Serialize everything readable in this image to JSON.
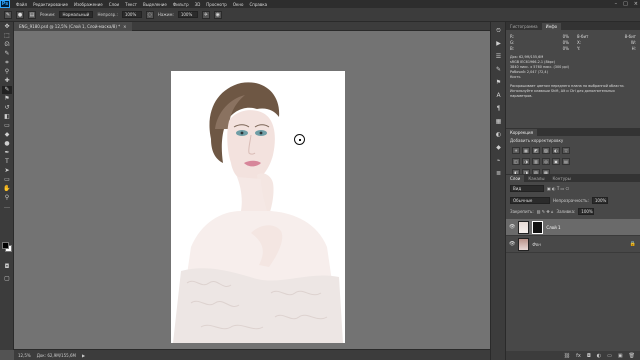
{
  "app": {
    "logo": "Ps"
  },
  "menu": [
    "Файл",
    "Редактирование",
    "Изображение",
    "Слои",
    "Текст",
    "Выделение",
    "Фильтр",
    "3D",
    "Просмотр",
    "Окно",
    "Справка"
  ],
  "window_controls": [
    "–",
    "□",
    "×"
  ],
  "options": {
    "mode_label": "Режим:",
    "mode_value": "Нормальный",
    "opacity_label": "Непрозр.:",
    "opacity_value": "100%",
    "flow_label": "Нажим:",
    "flow_value": "100%"
  },
  "document": {
    "tab_title": "ENG_9180.psd @ 12,5% (Слой 1, Слой-маска/8) *",
    "close": "×",
    "zoom": "12,5%",
    "doc_size": "Док: 62,9М/155,6М"
  },
  "panel_info": {
    "tabs": [
      "Гистограмма",
      "Инфо"
    ],
    "rows": [
      [
        "R:",
        "0%"
      ],
      [
        "G:",
        "0%"
      ],
      [
        "B:",
        "0%"
      ],
      [
        "8-бит",
        "8-бит"
      ],
      [
        "X:",
        "W:"
      ],
      [
        "Y:",
        "H:"
      ]
    ],
    "doc_lines": [
      "Док: 62,9М/155,6М",
      "sRGB IEC61966-2.1 (8bpc)",
      "3840 пикс. x 5760 пикс. (300 ppi)",
      "Рабочий: 2,047 (72,4)",
      "Кисть"
    ],
    "hint": "Раскрашивает цветом переднего плана на выбранной области. Используйте клавиши Shift, Alt и Ctrl для дополнительных параметров."
  },
  "panel_adjustments": {
    "title": "Коррекция",
    "subtitle": "Добавить корректировку",
    "row1": [
      "☀",
      "▦",
      "◩",
      "▨",
      "◐",
      "▽"
    ],
    "row2": [
      "◫",
      "◑",
      "▥",
      "◎",
      "▣",
      "▤"
    ],
    "row3": [
      "◧",
      "◨",
      "▧",
      "▩"
    ]
  },
  "panel_layers": {
    "tabs": [
      "Слои",
      "Каналы",
      "Контуры"
    ],
    "filter_value": "Вид",
    "blend_value": "Обычные",
    "opacity_label": "Непрозрачность:",
    "opacity_value": "100%",
    "lock_label": "Закрепить:",
    "fill_label": "Заливка:",
    "fill_value": "100%",
    "layers": [
      {
        "name": "Слой 1",
        "selected": true
      },
      {
        "name": "Фон",
        "selected": false
      }
    ]
  }
}
